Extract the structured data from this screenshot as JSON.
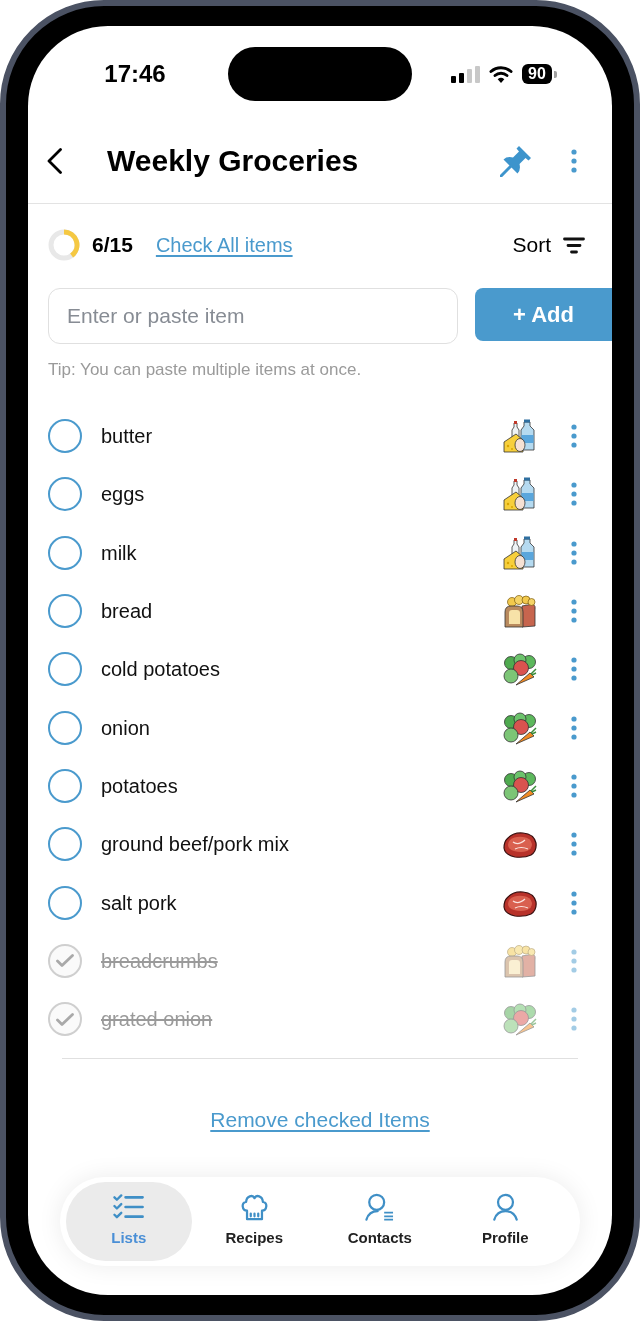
{
  "status_bar": {
    "time": "17:46",
    "battery": "90"
  },
  "header": {
    "title": "Weekly Groceries"
  },
  "progress": {
    "count": "6/15",
    "level": 0.4,
    "check_all": "Check All items",
    "sort": "Sort"
  },
  "add_item": {
    "placeholder": "Enter or paste item",
    "button": "+ Add",
    "tip": "Tip: You can paste multiple items at once."
  },
  "items": [
    {
      "name": "butter",
      "kind": "dairy",
      "checked": false
    },
    {
      "name": "eggs",
      "kind": "dairy",
      "checked": false
    },
    {
      "name": "milk",
      "kind": "dairy",
      "checked": false
    },
    {
      "name": "bread",
      "kind": "bakery",
      "checked": false
    },
    {
      "name": "cold potatoes",
      "kind": "produce",
      "checked": false
    },
    {
      "name": "onion",
      "kind": "produce",
      "checked": false
    },
    {
      "name": "potatoes",
      "kind": "produce",
      "checked": false
    },
    {
      "name": "ground beef/pork mix",
      "kind": "meat",
      "checked": false
    },
    {
      "name": "salt pork",
      "kind": "meat",
      "checked": false
    },
    {
      "name": "breadcrumbs",
      "kind": "bakery",
      "checked": true
    },
    {
      "name": "grated onion",
      "kind": "produce",
      "checked": true
    }
  ],
  "remove_checked": "Remove checked Items",
  "tabs": [
    {
      "label": "Lists",
      "kind": "lists",
      "selected": true
    },
    {
      "label": "Recipes",
      "kind": "recipes",
      "selected": false
    },
    {
      "label": "Contacts",
      "kind": "contacts",
      "selected": false
    },
    {
      "label": "Profile",
      "kind": "profile",
      "selected": false
    }
  ]
}
